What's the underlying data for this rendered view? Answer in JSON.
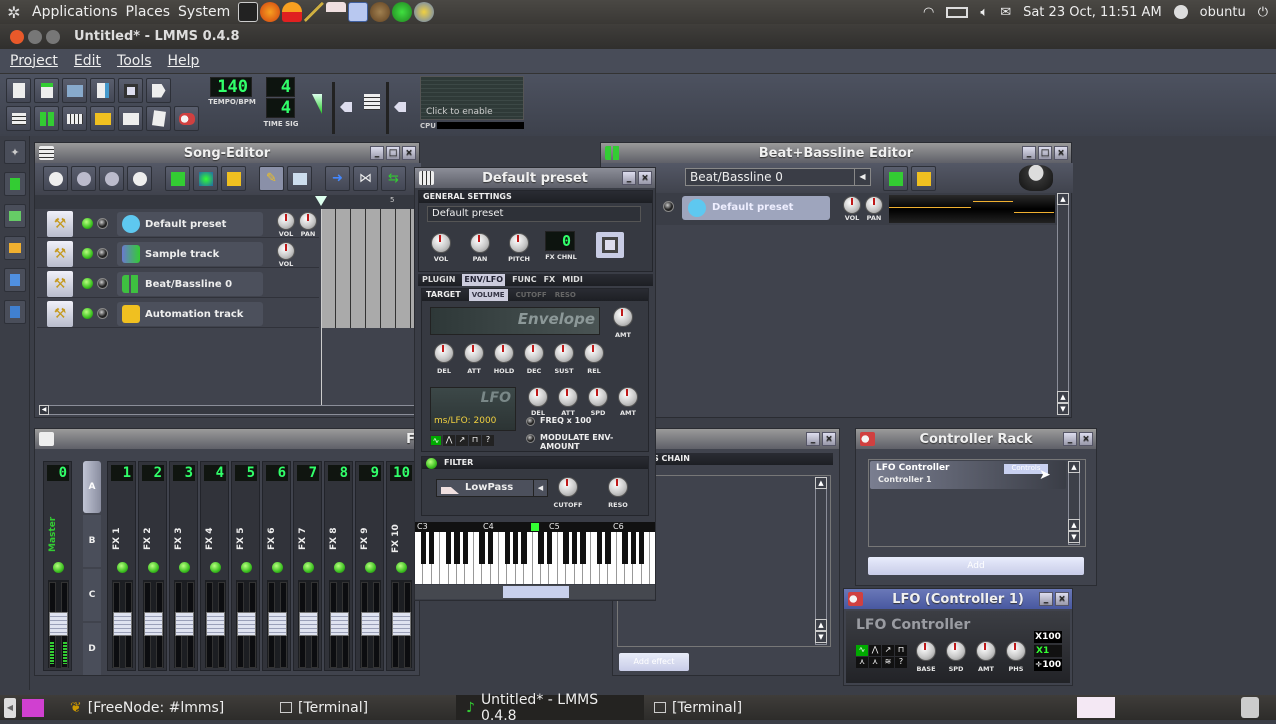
{
  "top_panel": {
    "menus": [
      "Applications",
      "Places",
      "System"
    ],
    "launchers": [
      "terminal-icon",
      "firefox-icon",
      "vlc-icon",
      "pen-icon",
      "keyboard-icon",
      "hydrogen-icon",
      "gimp-icon",
      "lmms-icon",
      "fruity-icon"
    ],
    "tray": {
      "datetime": "Sat 23 Oct, 11:51 AM",
      "user": "obuntu"
    }
  },
  "window": {
    "title": "Untitled* - LMMS 0.4.8"
  },
  "menubar": {
    "items": [
      "Project",
      "Edit",
      "Tools",
      "Help"
    ]
  },
  "toolbar": {
    "tempo": "140",
    "tempo_label": "TEMPO/BPM",
    "timesig_num": "4",
    "timesig_den": "4",
    "timesig_label": "TIME SIG",
    "cpu_click": "Click to enable",
    "cpu_label": "CPU"
  },
  "song_editor": {
    "title": "Song-Editor",
    "tracks": [
      {
        "name": "Default preset",
        "knobs": [
          "VOL",
          "PAN"
        ],
        "color": "#5ec8f0"
      },
      {
        "name": "Sample track",
        "knobs": [
          "VOL"
        ],
        "color": "#6a7ad0"
      },
      {
        "name": "Beat/Bassline 0",
        "knobs": [],
        "color": "#3ec040"
      },
      {
        "name": "Automation track",
        "knobs": [],
        "color": "#f0c020"
      }
    ],
    "timeline_marker": "5"
  },
  "instrument": {
    "title": "Default preset",
    "general_settings": "GENERAL SETTINGS",
    "preset_name": "Default preset",
    "knobs": [
      "VOL",
      "PAN",
      "PITCH"
    ],
    "fx_chnl_value": "0",
    "fx_chnl_label": "FX CHNL",
    "tabs": [
      "PLUGIN",
      "ENV/LFO",
      "FUNC",
      "FX",
      "MIDI"
    ],
    "active_tab": "ENV/LFO",
    "target_label": "TARGET",
    "targets": [
      "VOLUME",
      "CUTOFF",
      "RESO"
    ],
    "envelope_label": "Envelope",
    "amt_label": "AMT",
    "env_knobs": [
      "DEL",
      "ATT",
      "HOLD",
      "DEC",
      "SUST",
      "REL"
    ],
    "lfo_label": "LFO",
    "lfo_readout": "ms/LFO:  2000",
    "lfo_knobs": [
      "DEL",
      "ATT",
      "SPD",
      "AMT"
    ],
    "freq_x100": "FREQ x 100",
    "modulate_env": "MODULATE ENV-AMOUNT",
    "filter_label": "FILTER",
    "filter_type": "LowPass",
    "filter_knobs": [
      "CUTOFF",
      "RESO"
    ],
    "piano_octaves": [
      "C3",
      "C4",
      "C5",
      "C6"
    ]
  },
  "beat_bassline": {
    "title": "Beat+Bassline Editor",
    "selected": "Beat/Bassline 0",
    "track_name": "Default preset",
    "knobs": [
      "VOL",
      "PAN"
    ]
  },
  "fx_mixer": {
    "title_partial": "F",
    "master": {
      "num": "0",
      "name": "Master"
    },
    "banks": [
      "A",
      "B",
      "C",
      "D"
    ],
    "active_bank": "A",
    "channels": [
      {
        "num": "1",
        "name": "FX 1"
      },
      {
        "num": "2",
        "name": "FX 2"
      },
      {
        "num": "3",
        "name": "FX 3"
      },
      {
        "num": "4",
        "name": "FX 4"
      },
      {
        "num": "5",
        "name": "FX 5"
      },
      {
        "num": "6",
        "name": "FX 6"
      },
      {
        "num": "7",
        "name": "FX 7"
      },
      {
        "num": "8",
        "name": "FX 8"
      },
      {
        "num": "9",
        "name": "FX 9"
      },
      {
        "num": "10",
        "name": "FX 10"
      }
    ]
  },
  "effects_chain": {
    "header_partial": "S CHAIN",
    "add_button": "Add effect"
  },
  "controller_rack": {
    "title": "Controller Rack",
    "controller_type": "LFO Controller",
    "controller_name": "Controller 1",
    "controls_button": "Controls",
    "add_button": "Add"
  },
  "lfo_controller": {
    "title": "LFO (Controller 1)",
    "heading": "LFO Controller",
    "knobs": [
      "BASE",
      "SPD",
      "AMT",
      "PHS"
    ],
    "multipliers": [
      "X100",
      "X1",
      "÷100"
    ],
    "active_multiplier": "X1"
  },
  "taskbar": {
    "tasks": [
      {
        "label": "[FreeNode: #lmms]",
        "icon": "xchat-icon"
      },
      {
        "label": "[Terminal]",
        "icon": "terminal-icon"
      },
      {
        "label": "Untitled* - LMMS 0.4.8",
        "icon": "lmms-icon",
        "active": true
      },
      {
        "label": "[Terminal]",
        "icon": "terminal-icon"
      }
    ]
  }
}
